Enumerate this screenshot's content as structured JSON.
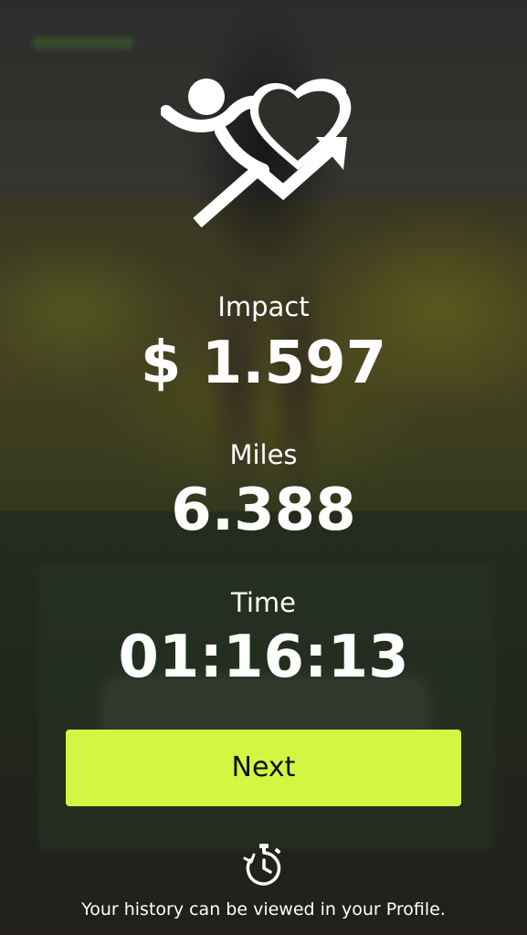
{
  "impact": {
    "label": "Impact",
    "value": "$ 1.597"
  },
  "miles": {
    "label": "Miles",
    "value": "6.388"
  },
  "time": {
    "label": "Time",
    "value": "01:16:13"
  },
  "next_button": {
    "label": "Next"
  },
  "footer": {
    "text": "Your history can be viewed in your Profile."
  },
  "icons": {
    "logo": "runner-heart-arrow-logo",
    "history": "stopwatch-history-icon"
  },
  "colors": {
    "accent": "#d4f542",
    "text": "#ffffff",
    "button_text": "#111111"
  }
}
